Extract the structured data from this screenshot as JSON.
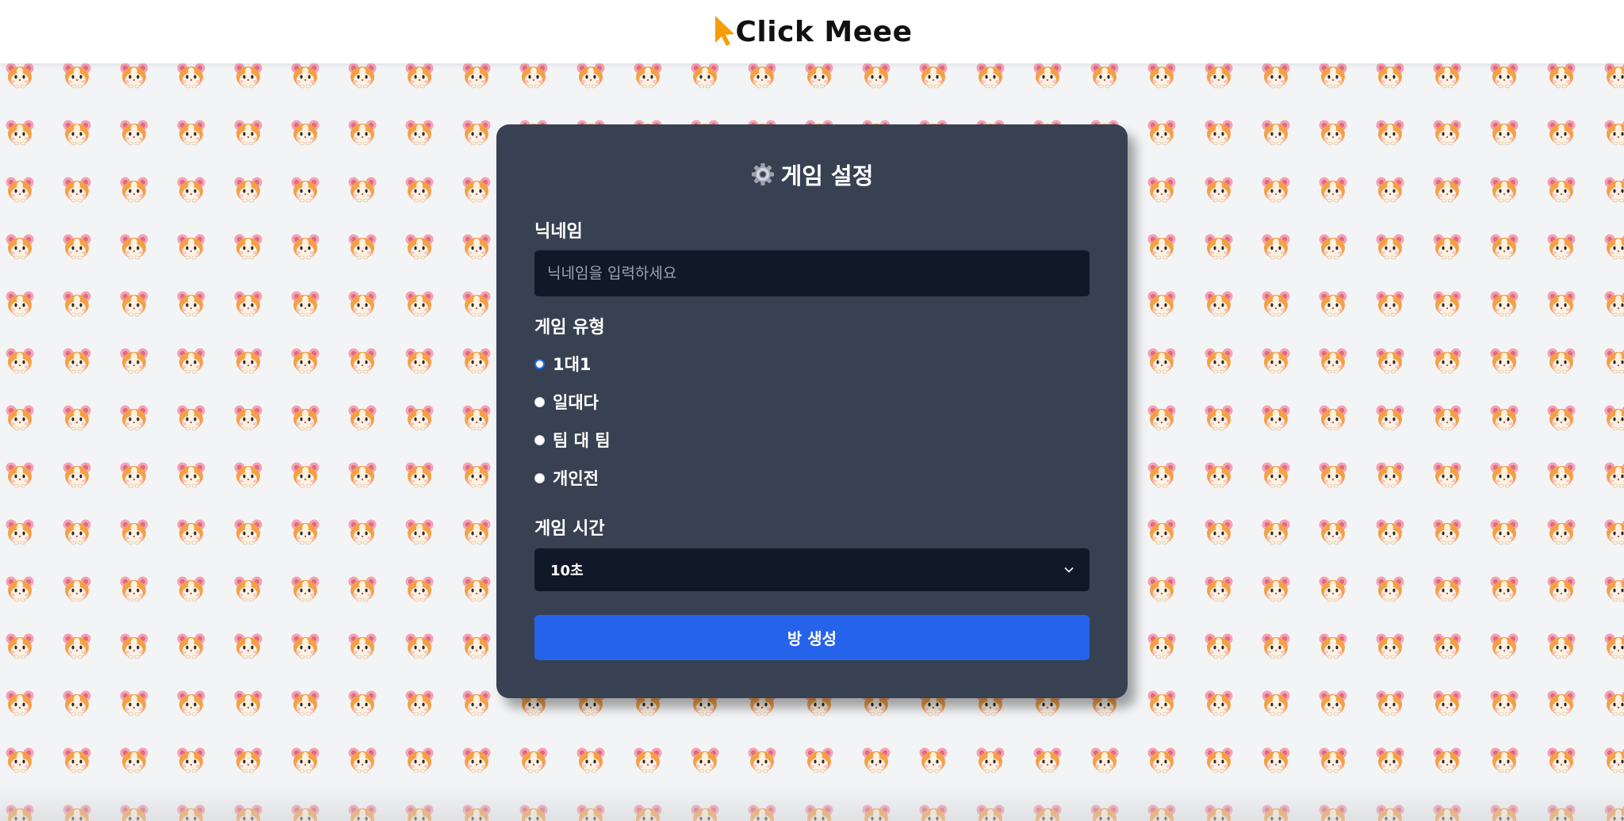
{
  "header": {
    "brand": "Click Meee",
    "logo_icon": "cursor-arrow-icon",
    "accent_color": "#f59e0b"
  },
  "background": {
    "pattern_icon": "hamster-face-icon"
  },
  "settings": {
    "title": "게임 설정",
    "title_icon": "gear-icon",
    "nickname": {
      "label": "닉네임",
      "placeholder": "닉네임을 입력하세요",
      "value": ""
    },
    "game_type": {
      "label": "게임 유형",
      "options": [
        "1대1",
        "일대다",
        "팀 대 팀",
        "개인전"
      ],
      "selected": "1대1"
    },
    "game_time": {
      "label": "게임 시간",
      "selected": "10초"
    },
    "create_button": "방 생성"
  },
  "colors": {
    "card": "#374151",
    "input": "#111827",
    "button": "#2563eb",
    "radio_checked": "#1d6ff2"
  }
}
